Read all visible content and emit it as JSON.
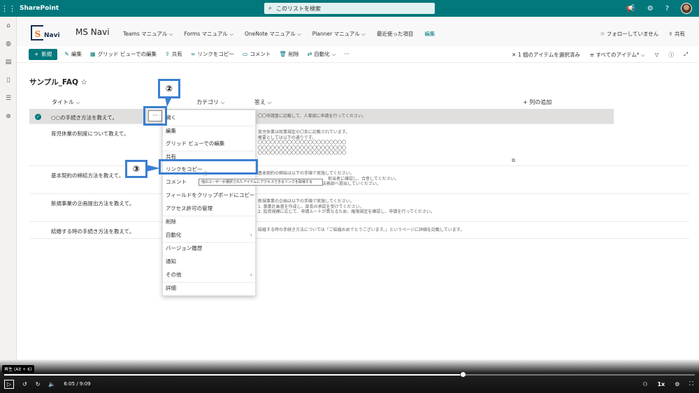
{
  "suitebar": {
    "app": "SharePoint",
    "search_placeholder": "このリストを検索"
  },
  "site": {
    "name": "MS Navi",
    "logo_text": "MSNavi",
    "nav": [
      "Teams マニュアル",
      "Forms マニュアル",
      "OneNote マニュアル",
      "Planner マニュアル",
      "最近使った項目",
      "編集"
    ],
    "follow": "フォローしていません",
    "share": "共有"
  },
  "commands": {
    "new": "新規",
    "items": [
      "編集",
      "グリッド ビューでの編集",
      "共有",
      "リンクをコピー",
      "コメント",
      "削除",
      "自動化"
    ],
    "selected": "1 個のアイテムを選択済み",
    "view": "すべてのアイテム*"
  },
  "list": {
    "title": "サンプル_FAQ",
    "columns": {
      "title": "タイトル",
      "category": "カテゴリ",
      "answer": "答え",
      "add": "列の追加"
    },
    "rows": [
      {
        "title": "○○の手続き方法を教えて。",
        "answer": [
          "〇〇申請書に記載して、人事部に申請を行ってください。"
        ]
      },
      {
        "title": "育児休業の制度について教えて。",
        "answer": [
          "育児休業は就業規定の〇条に記載されています。",
          "概要としては以下の通りです。",
          "〇〇〇〇〇〇〇〇〇〇〇〇〇〇〇〇〇〇〇〇〇",
          "〇〇〇〇〇〇〇〇〇〇〇〇〇〇〇〇〇〇〇〇〇",
          "〇〇〇〇〇〇〇〇〇〇〇〇〇〇〇〇〇〇〇〇〇"
        ]
      },
      {
        "title": "基本契約の締結方法を教えて。",
        "answer": [
          "基本契約の締結は以下の手順で実施してください。",
          "担当者に確認し、合意してください。",
          "を法務部へ提出していください。"
        ]
      },
      {
        "title": "新規事業の企画提出方法を教えて。",
        "answer": [
          "新規事業の企画は以下の手順で実施してください。",
          "1. 事業計画書を作成し、部長の承認を受けてください。",
          "2. 投資規模に応じて、申請ルートが異なるため、権限規定を確認し、申請を行ってください。"
        ]
      },
      {
        "title": "結婚する時の手続き方法を教えて。",
        "answer": [
          "結婚する時の手続き方法については「ご結婚おめでとうございます。」というページに詳細を記載しています。"
        ]
      }
    ]
  },
  "menu": {
    "items": [
      "開く",
      "編集",
      "グリッド ビューでの編集",
      "共有",
      "リンクをコピー",
      "コメント",
      "フィールドをクリップボードにコピー",
      "アクセス許可の管理",
      "削除",
      "自動化",
      "バージョン履歴",
      "通知",
      "その他",
      "詳細"
    ],
    "tooltip": "他のユーザーが選択されたアイテムにアクセスできるリンクを取得する"
  },
  "annotations": {
    "step2": "②",
    "step3": "③"
  },
  "player": {
    "tooltip": "再生 (Alt + K)",
    "time": "6:05 / 9:09",
    "speed": "1x",
    "progress": 0.66
  },
  "colors": {
    "accent": "#03787c",
    "annotation": "#3b7fd0"
  }
}
